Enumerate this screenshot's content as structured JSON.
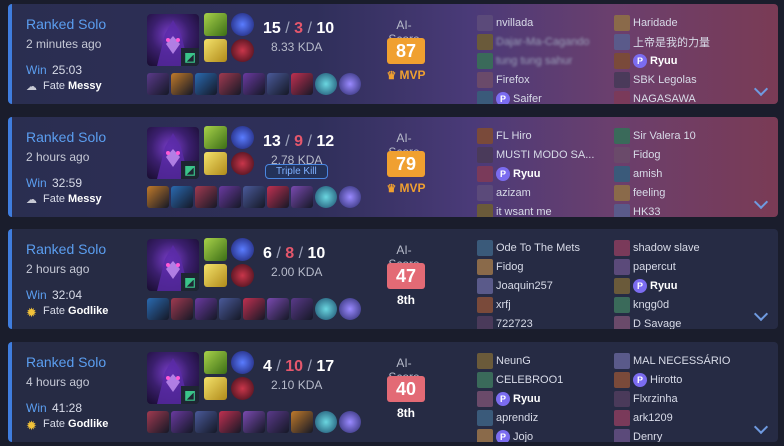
{
  "ai_score_label": "AI-Score",
  "matches": [
    {
      "queue": "Ranked Solo",
      "ago": "2 minutes ago",
      "result": "Win",
      "duration": "25:03",
      "fate_label": "Fate",
      "fate_value": "Messy",
      "weather_icon": "cloud-rain-icon",
      "kills": "15",
      "deaths": "3",
      "assists": "10",
      "kda": "8.33 KDA",
      "multikill": "",
      "ai_score": "87",
      "score_color": "gold",
      "rank": "MVP",
      "team1": [
        "nvillada",
        "Dajar-Ma-Cagando",
        "tung tung sahur",
        "Firefox",
        "Saifer"
      ],
      "team1_badges": [
        false,
        false,
        false,
        false,
        true
      ],
      "team2": [
        "Haridade",
        "上帝是我的力量",
        "Ryuu",
        "SBK Legolas",
        "NAGASAWA"
      ],
      "team2_badges": [
        false,
        false,
        true,
        false,
        false
      ],
      "me_team": 2,
      "me_index": 2
    },
    {
      "queue": "Ranked Solo",
      "ago": "2 hours ago",
      "result": "Win",
      "duration": "32:59",
      "fate_label": "Fate",
      "fate_value": "Messy",
      "weather_icon": "cloud-rain-icon",
      "kills": "13",
      "deaths": "9",
      "assists": "12",
      "kda": "2.78 KDA",
      "multikill": "Triple Kill",
      "ai_score": "79",
      "score_color": "gold",
      "rank": "MVP",
      "team1": [
        "FL Hiro",
        "MUSTI MODO SA...",
        "Ryuu",
        "azizam",
        "it wsant me"
      ],
      "team1_badges": [
        false,
        false,
        true,
        false,
        false
      ],
      "team2": [
        "Sir Valera 10",
        "Fidog",
        "amish",
        "feeling",
        "HK33"
      ],
      "team2_badges": [
        false,
        false,
        false,
        false,
        false
      ],
      "me_team": 1,
      "me_index": 2
    },
    {
      "queue": "Ranked Solo",
      "ago": "2 hours ago",
      "result": "Win",
      "duration": "32:04",
      "fate_label": "Fate",
      "fate_value": "Godlike",
      "weather_icon": "sun-icon",
      "kills": "6",
      "deaths": "8",
      "assists": "10",
      "kda": "2.00 KDA",
      "multikill": "",
      "ai_score": "47",
      "score_color": "red",
      "rank": "8th",
      "team1": [
        "Ode To The Mets",
        "Fidog",
        "Joaquin257",
        "xrfj",
        "722723"
      ],
      "team1_badges": [
        false,
        false,
        false,
        false,
        false
      ],
      "team2": [
        "shadow slave",
        "papercut",
        "Ryuu",
        "kngg0d",
        "D Savage"
      ],
      "team2_badges": [
        false,
        false,
        true,
        false,
        false
      ],
      "me_team": 2,
      "me_index": 2
    },
    {
      "queue": "Ranked Solo",
      "ago": "4 hours ago",
      "result": "Win",
      "duration": "41:28",
      "fate_label": "Fate",
      "fate_value": "Godlike",
      "weather_icon": "sun-icon",
      "kills": "4",
      "deaths": "10",
      "assists": "17",
      "kda": "2.10 KDA",
      "multikill": "",
      "ai_score": "40",
      "score_color": "red",
      "rank": "8th",
      "team1": [
        "NeunG",
        "CELEBROO1",
        "Ryuu",
        "aprendiz",
        "Jojo"
      ],
      "team1_badges": [
        false,
        false,
        true,
        false,
        true
      ],
      "team2": [
        "MAL NECESSÁRIO",
        "Hirotto",
        "Flxrzinha",
        "ark1209",
        "Denry"
      ],
      "team2_badges": [
        false,
        true,
        false,
        false,
        false
      ],
      "me_team": 1,
      "me_index": 2
    }
  ]
}
